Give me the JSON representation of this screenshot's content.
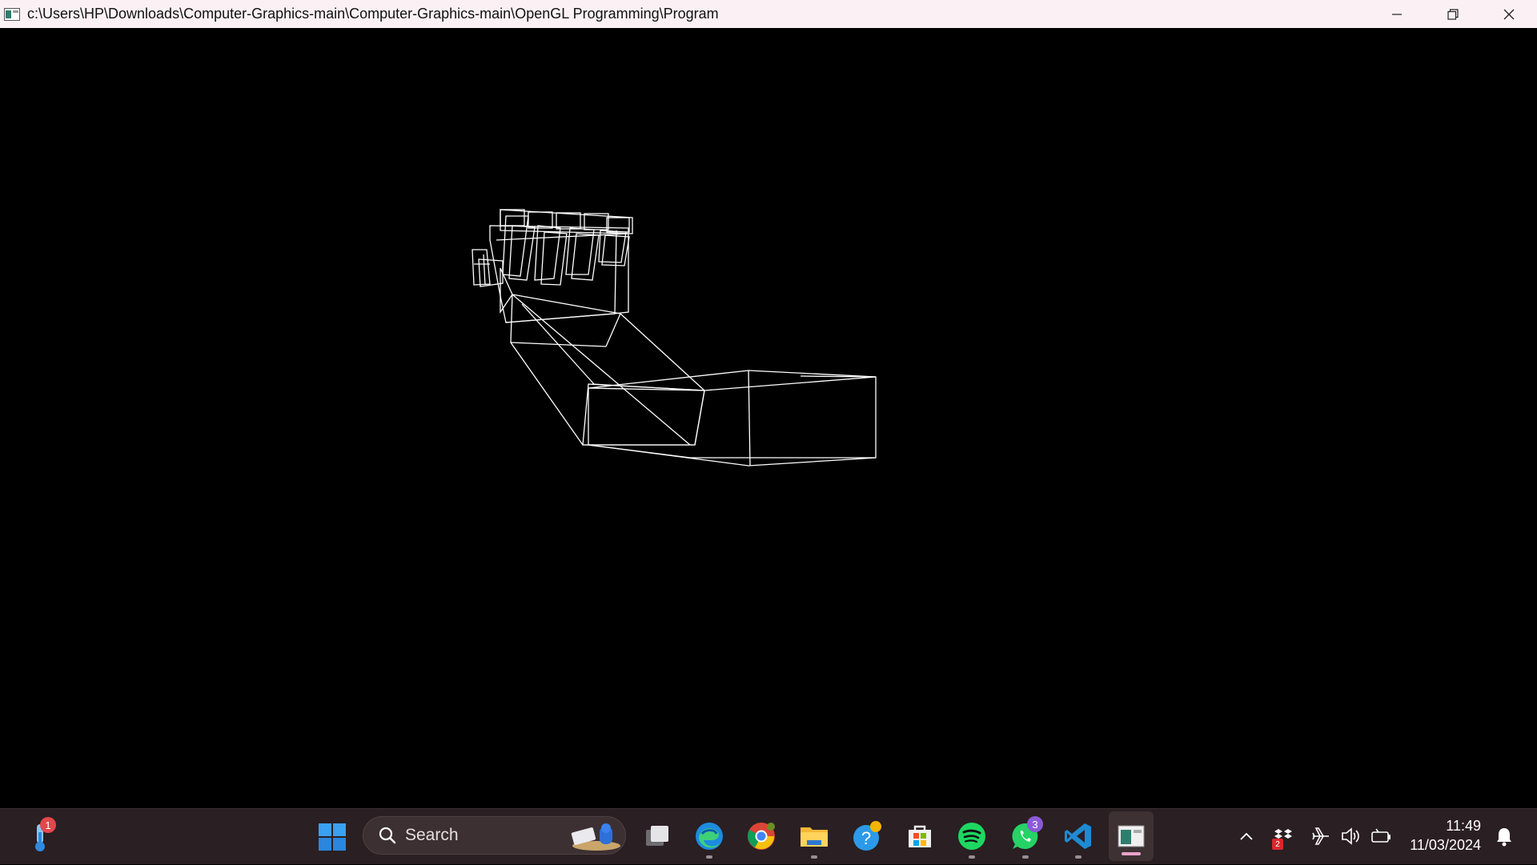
{
  "window": {
    "title": "c:\\Users\\HP\\Downloads\\Computer-Graphics-main\\Computer-Graphics-main\\OpenGL Programming\\Program"
  },
  "taskbar": {
    "weather_badge": "1",
    "search_placeholder": "Search",
    "whatsapp_badge": "3",
    "dropbox_badge": "2",
    "time": "11:49",
    "date": "11/03/2024"
  },
  "colors": {
    "titlebar_bg": "#fbf1f4",
    "taskbar_bg": "#2a1f22",
    "wireframe": "#ffffff",
    "badge_red": "#e0484c",
    "badge_purple": "#8a5bd6"
  }
}
